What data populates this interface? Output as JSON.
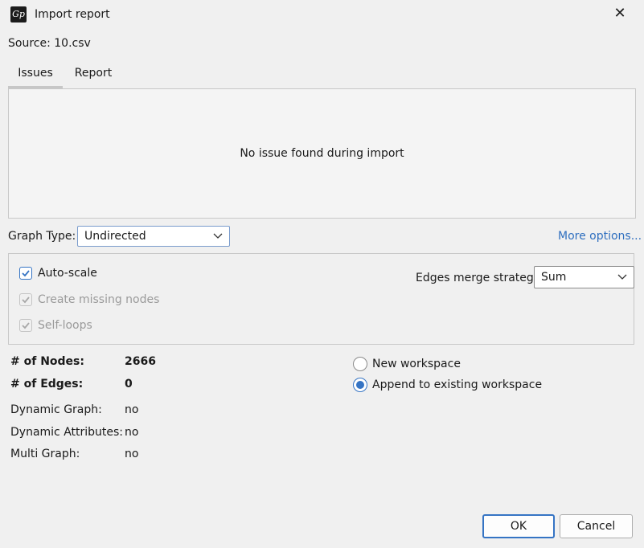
{
  "window": {
    "title": "Import report",
    "close_glyph": "✕",
    "app_icon_text": "Gp"
  },
  "source": {
    "label": "Source:",
    "value": "10.csv"
  },
  "tabs": [
    {
      "label": "Issues",
      "selected": true
    },
    {
      "label": "Report",
      "selected": false
    }
  ],
  "issues_panel": {
    "message": "No issue found during import"
  },
  "graph_type": {
    "label": "Graph Type:",
    "value": "Undirected"
  },
  "more_options": "More options...",
  "options": {
    "auto_scale": {
      "label": "Auto-scale",
      "checked": true,
      "enabled": true
    },
    "create_missing_nodes": {
      "label": "Create missing nodes",
      "checked": true,
      "enabled": false
    },
    "self_loops": {
      "label": "Self-loops",
      "checked": true,
      "enabled": false
    },
    "merge_strategy": {
      "label": "Edges merge strategy:",
      "value": "Sum"
    }
  },
  "stats": {
    "nodes": {
      "label": "# of Nodes:",
      "value": "2666"
    },
    "edges": {
      "label": "# of Edges:",
      "value": "0"
    },
    "dynamic_graph": {
      "label": "Dynamic Graph:",
      "value": "no"
    },
    "dynamic_attributes": {
      "label": "Dynamic Attributes:",
      "value": "no"
    },
    "multi_graph": {
      "label": "Multi Graph:",
      "value": "no"
    }
  },
  "workspace": {
    "new": {
      "label": "New workspace",
      "selected": false
    },
    "append": {
      "label": "Append to existing workspace",
      "selected": true
    }
  },
  "buttons": {
    "ok": "OK",
    "cancel": "Cancel"
  },
  "colors": {
    "accent": "#3574c4",
    "link": "#2f6fbf"
  }
}
